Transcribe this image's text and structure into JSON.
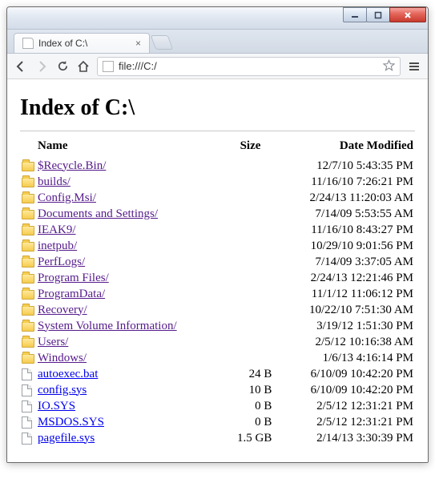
{
  "tab": {
    "title": "Index of C:\\"
  },
  "url": "file:///C:/",
  "page": {
    "heading": "Index of C:\\"
  },
  "columns": {
    "name": "Name",
    "size": "Size",
    "date": "Date Modified"
  },
  "entries": [
    {
      "type": "dir",
      "name": "$Recycle.Bin/",
      "size": "",
      "date": "12/7/10 5:43:35 PM"
    },
    {
      "type": "dir",
      "name": "builds/",
      "size": "",
      "date": "11/16/10 7:26:21 PM"
    },
    {
      "type": "dir",
      "name": "Config.Msi/",
      "size": "",
      "date": "2/24/13 11:20:03 AM"
    },
    {
      "type": "dir",
      "name": "Documents and Settings/",
      "size": "",
      "date": "7/14/09 5:53:55 AM"
    },
    {
      "type": "dir",
      "name": "IEAK9/",
      "size": "",
      "date": "11/16/10 8:43:27 PM"
    },
    {
      "type": "dir",
      "name": "inetpub/",
      "size": "",
      "date": "10/29/10 9:01:56 PM"
    },
    {
      "type": "dir",
      "name": "PerfLogs/",
      "size": "",
      "date": "7/14/09 3:37:05 AM"
    },
    {
      "type": "dir",
      "name": "Program Files/",
      "size": "",
      "date": "2/24/13 12:21:46 PM"
    },
    {
      "type": "dir",
      "name": "ProgramData/",
      "size": "",
      "date": "11/1/12 11:06:12 PM"
    },
    {
      "type": "dir",
      "name": "Recovery/",
      "size": "",
      "date": "10/22/10 7:51:30 AM"
    },
    {
      "type": "dir",
      "name": "System Volume Information/",
      "size": "",
      "date": "3/19/12 1:51:30 PM"
    },
    {
      "type": "dir",
      "name": "Users/",
      "size": "",
      "date": "2/5/12 10:16:38 AM"
    },
    {
      "type": "dir",
      "name": "Windows/",
      "size": "",
      "date": "1/6/13 4:16:14 PM"
    },
    {
      "type": "file",
      "name": "autoexec.bat",
      "size": "24 B",
      "date": "6/10/09 10:42:20 PM"
    },
    {
      "type": "file",
      "name": "config.sys",
      "size": "10 B",
      "date": "6/10/09 10:42:20 PM"
    },
    {
      "type": "file",
      "name": "IO.SYS",
      "size": "0 B",
      "date": "2/5/12 12:31:21 PM"
    },
    {
      "type": "file",
      "name": "MSDOS.SYS",
      "size": "0 B",
      "date": "2/5/12 12:31:21 PM"
    },
    {
      "type": "file",
      "name": "pagefile.sys",
      "size": "1.5 GB",
      "date": "2/14/13 3:30:39 PM"
    }
  ]
}
